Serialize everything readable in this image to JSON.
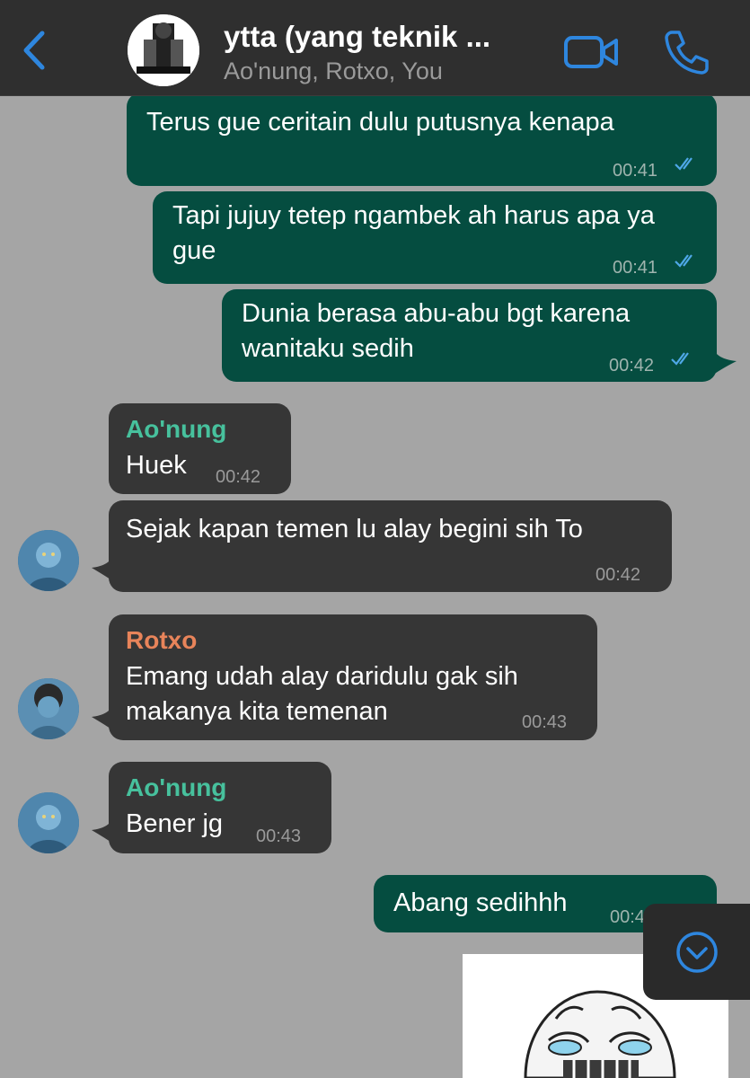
{
  "header": {
    "title": "ytta (yang teknik ...",
    "subtitle": "Ao'nung, Rotxo, You",
    "back_icon": "chevron-left-icon",
    "video_icon": "video-camera-icon",
    "call_icon": "phone-icon",
    "accent": "#2e86de"
  },
  "messages": [
    {
      "type": "out",
      "text": "Terus gue ceritain dulu putusnya kenapa",
      "time": "00:41"
    },
    {
      "type": "out",
      "text": "Tapi jujuy tetep ngambek ah harus apa ya gue",
      "time": "00:41"
    },
    {
      "type": "out",
      "text": "Dunia berasa abu-abu bgt karena wanitaku sedih",
      "time": "00:42"
    },
    {
      "type": "in",
      "sender": "Ao'nung",
      "sender_color": "#47c19d",
      "text": "Huek",
      "time": "00:42"
    },
    {
      "type": "in",
      "text": "Sejak kapan temen lu alay begini sih To",
      "time": "00:42"
    },
    {
      "type": "in",
      "sender": "Rotxo",
      "sender_color": "#e8845a",
      "text": "Emang udah alay daridulu gak sih makanya kita temenan",
      "time": "00:43"
    },
    {
      "type": "in",
      "sender": "Ao'nung",
      "sender_color": "#47c19d",
      "text": "Bener jg",
      "time": "00:43"
    },
    {
      "type": "out",
      "text": "Abang sedihhh",
      "time": "00:43"
    }
  ],
  "scroll_down_icon": "chevron-down-circle-icon",
  "colors": {
    "background": "#a5a5a5",
    "outgoing_bubble": "#054d40",
    "incoming_bubble": "#363636",
    "read_ticks": "#4fa8e8"
  }
}
